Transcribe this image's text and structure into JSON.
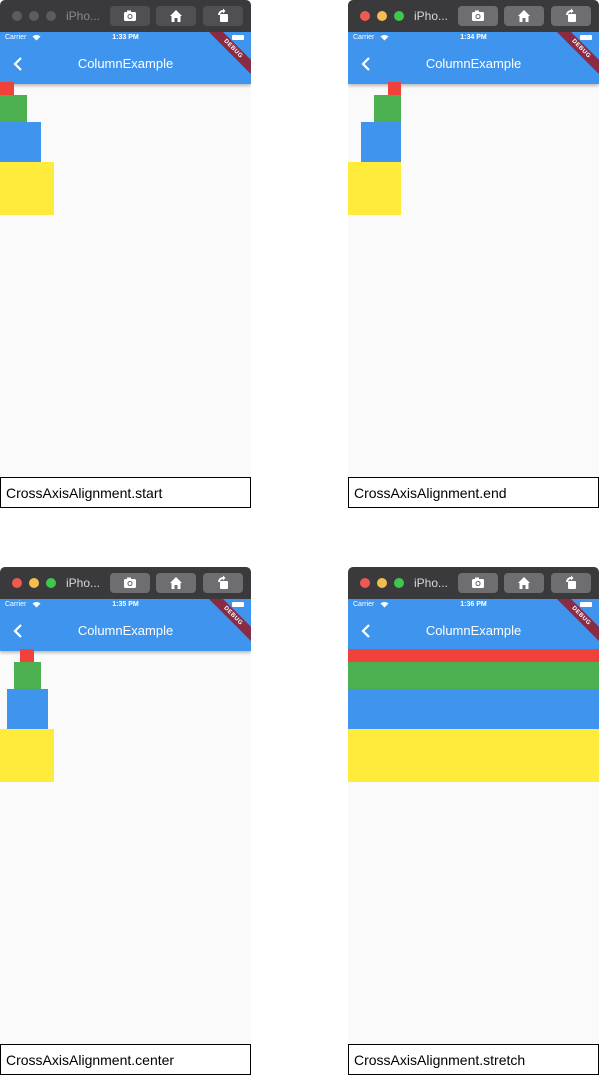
{
  "panels": [
    {
      "sim_title": "iPho...",
      "time": "1:33 PM",
      "carrier": "Carrier",
      "app_title": "ColumnExample",
      "debug_banner": "DEBUG",
      "caption": "CrossAxisAlignment.start",
      "window_state": "inactive"
    },
    {
      "sim_title": "iPho...",
      "time": "1:34 PM",
      "carrier": "Carrier",
      "app_title": "ColumnExample",
      "debug_banner": "DEBUG",
      "caption": "CrossAxisAlignment.end",
      "window_state": "active"
    },
    {
      "sim_title": "iPho...",
      "time": "1:35 PM",
      "carrier": "Carrier",
      "app_title": "ColumnExample",
      "debug_banner": "DEBUG",
      "caption": "CrossAxisAlignment.center",
      "window_state": "active"
    },
    {
      "sim_title": "iPho...",
      "time": "1:36 PM",
      "carrier": "Carrier",
      "app_title": "ColumnExample",
      "debug_banner": "DEBUG",
      "caption": "CrossAxisAlignment.stretch",
      "window_state": "active"
    }
  ],
  "colors": {
    "app_bar": "#3f95ee",
    "red_box": "#f0423a",
    "green_box": "#4caf50",
    "blue_box": "#3f95ee",
    "yellow_box": "#ffeb3b",
    "background": "#fafafa",
    "debug_banner": "#8a2b44"
  },
  "icons": {
    "toolbar": [
      "screenshot-icon",
      "home-icon",
      "rotate-icon"
    ],
    "appbar": "back-arrow-icon",
    "status": [
      "wifi-icon",
      "battery-icon"
    ]
  }
}
